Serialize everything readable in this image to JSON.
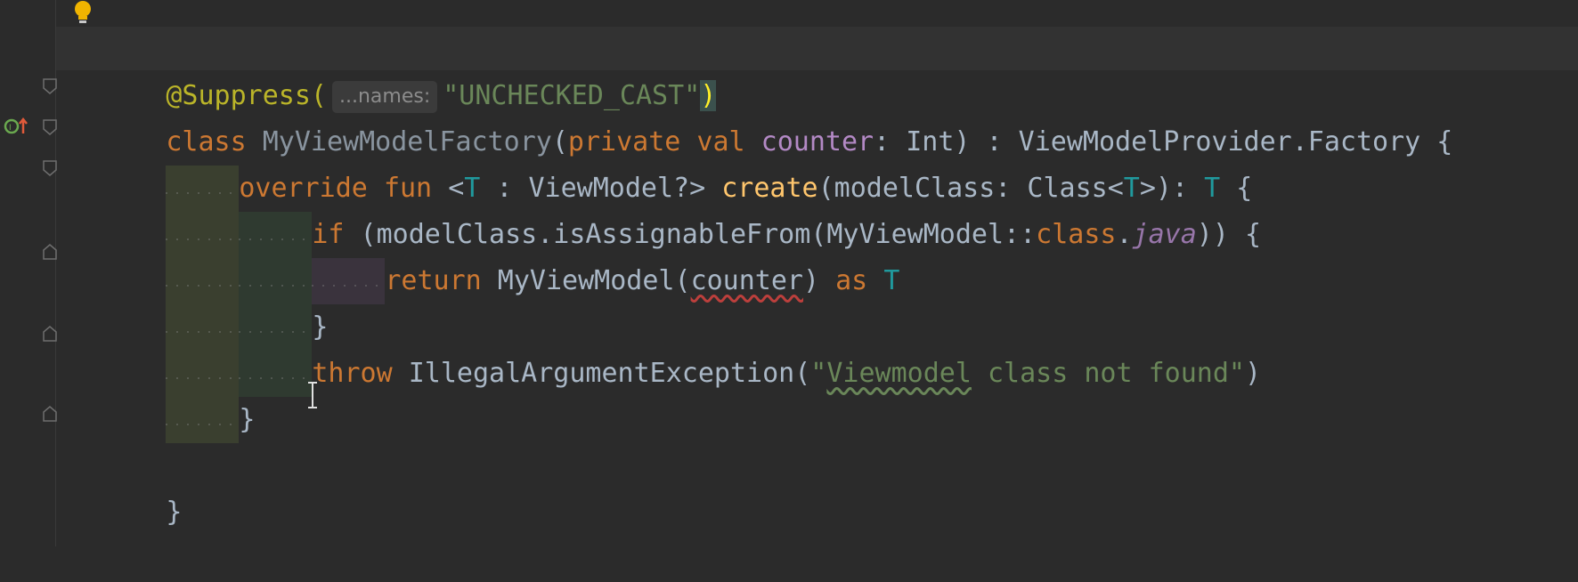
{
  "editor": {
    "lines": [
      {
        "annotation": "@Suppress(",
        "hint_label": "...names:",
        "string": "\"UNCHECKED_CAST\"",
        "close": ")"
      },
      {
        "kw_class": "class",
        "class_name": "MyViewModelFactory",
        "paren_open": "(",
        "kw_private": "private",
        "kw_val": "val",
        "param": "counter",
        "colon_type": ": Int) : ViewModelProvider.Factory {"
      },
      {
        "kw_override": "override",
        "kw_fun": "fun",
        "generic_open": "<",
        "t": "T",
        "generic_bound": " : ViewModel?>",
        "fn_name": "create",
        "params": "(modelClass: Class<",
        "t2": "T",
        "params_end": ">): ",
        "ret_t": "T",
        "brace": " {"
      },
      {
        "kw_if": "if",
        "cond_start": " (modelClass.isAssignableFrom(MyViewModel::",
        "kw_class": "class",
        "dot": ".",
        "java": "java",
        "cond_end": ")) {"
      },
      {
        "kw_return": "return",
        "ctor": " MyViewModel(",
        "arg": "counter",
        "close": ")",
        "kw_as": " as ",
        "t": "T"
      },
      {
        "brace": "}"
      },
      {
        "kw_throw": "throw",
        "exc": " IllegalArgumentException(",
        "str_q": "\"",
        "str_word": "Viewmodel",
        "str_rest": " class not found\"",
        "close": ")"
      },
      {
        "brace": "}"
      },
      {
        "empty": ""
      },
      {
        "brace": "}"
      }
    ]
  },
  "icons": {
    "bulb": "lightbulb-icon",
    "override": "override-marker-icon",
    "fold": "fold-marker-icon",
    "cursor": "text-cursor-icon"
  },
  "colors": {
    "background": "#2b2b2b",
    "keyword": "#cc7832",
    "function": "#ffc66d",
    "string": "#6a8759",
    "type_param": "#20999d",
    "annotation": "#bbb529"
  }
}
